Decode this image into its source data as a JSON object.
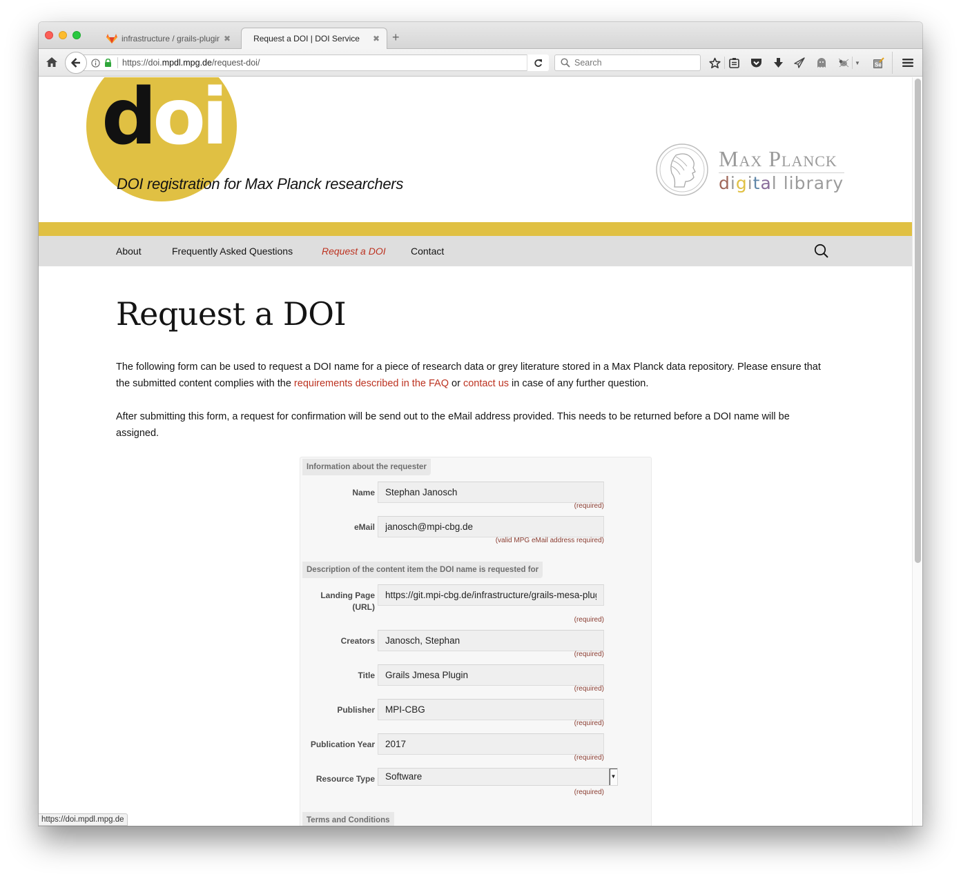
{
  "browser": {
    "tabs": [
      {
        "title": "infrastructure / grails-plugin-",
        "icon": "gitlab-fox-icon",
        "active": false
      },
      {
        "title": "Request a DOI | DOI Service",
        "active": true
      }
    ],
    "new_tab_label": "+",
    "url": {
      "prefix": "https://doi.",
      "host": "mpdl.mpg.de",
      "path": "/request-doi/"
    },
    "search_placeholder": "Search",
    "status_bar_link": "https://doi.mpdl.mpg.de"
  },
  "header": {
    "logo": {
      "d": "d",
      "oi": "oi"
    },
    "tagline": "DOI registration for Max Planck researchers",
    "partner": {
      "name": "Max Planck",
      "library_letters": [
        "d",
        "i",
        "g",
        "i",
        "t",
        "a",
        "l",
        " ",
        "l",
        "i",
        "b",
        "r",
        "a",
        "r",
        "y"
      ]
    }
  },
  "colors": {
    "brand_gold": "#e0c043",
    "link_red": "#bc3220",
    "nav_bg": "#dedede",
    "library_colors": [
      "#a0685a",
      "#9a9a9a",
      "#e0c043",
      "#9a9a9a",
      "#5f86a8",
      "#8a6d9a",
      "#9a9a9a"
    ]
  },
  "nav": {
    "items": [
      {
        "label": "About",
        "current": false
      },
      {
        "label": "Frequently Asked Questions",
        "current": false
      },
      {
        "label": "Request a DOI",
        "current": true
      },
      {
        "label": "Contact",
        "current": false
      }
    ]
  },
  "page": {
    "title": "Request a DOI",
    "intro1_a": "The following form can be used to request a DOI name for a piece of research data or grey literature stored in a Max Planck data repository. Please ensure that the submitted content complies with the ",
    "intro1_link1": "requirements described in the FAQ",
    "intro1_b": " or ",
    "intro1_link2": "contact us",
    "intro1_c": " in case of any further question.",
    "intro2": "After submitting this form, a request for confirmation will be send out to the eMail address provided. This needs to be returned before a DOI name will be assigned."
  },
  "form": {
    "section_requester": "Information about the requester",
    "section_content": "Description of the content item the DOI name is requested for",
    "section_terms": "Terms and Conditions",
    "fields": {
      "name": {
        "label": "Name",
        "value": "Stephan Janosch",
        "note": "(required)"
      },
      "email": {
        "label": "eMail",
        "value": "janosch@mpi-cbg.de",
        "note": "(valid MPG eMail address required)"
      },
      "landing": {
        "label": "Landing Page (URL)",
        "value": "https://git.mpi-cbg.de/infrastructure/grails-mesa-plugin",
        "note": "(required)"
      },
      "creators": {
        "label": "Creators",
        "value": "Janosch, Stephan",
        "note": "(required)"
      },
      "title": {
        "label": "Title",
        "value": "Grails Jmesa Plugin",
        "note": "(required)"
      },
      "publisher": {
        "label": "Publisher",
        "value": "MPI-CBG",
        "note": "(required)"
      },
      "year": {
        "label": "Publication Year",
        "value": "2017",
        "note": "(required)"
      },
      "resource_type": {
        "label": "Resource Type",
        "value": "Software",
        "note": "(required)"
      }
    }
  }
}
